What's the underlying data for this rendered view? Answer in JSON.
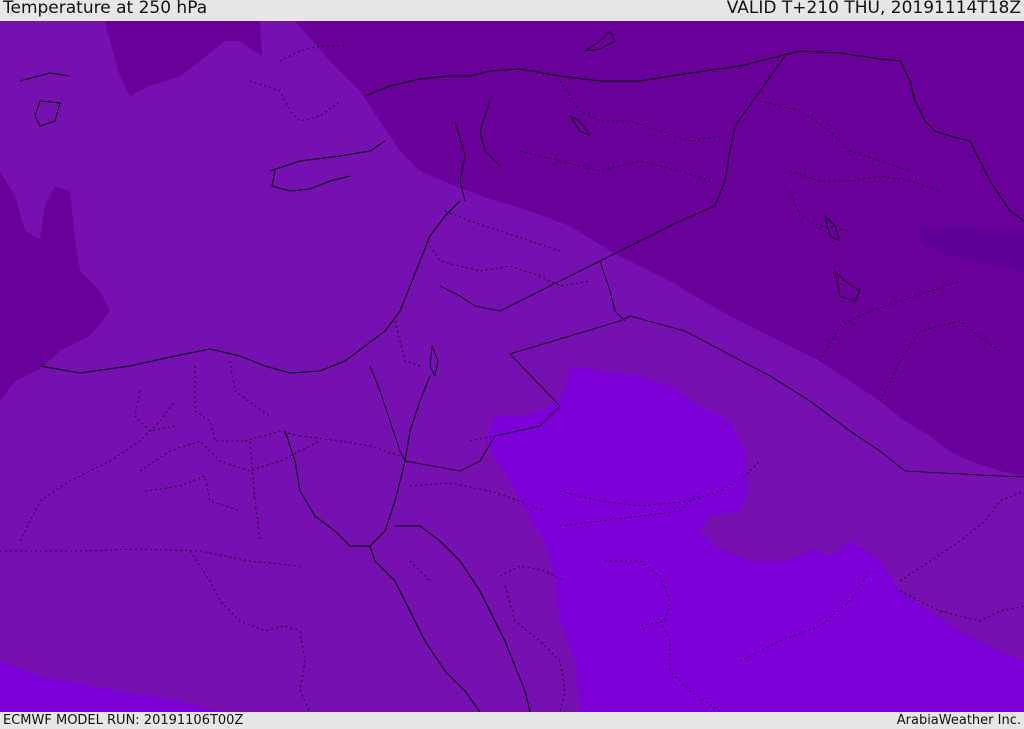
{
  "header": {
    "title": "Temperature at 250 hPa",
    "valid_time": "VALID T+210 THU, 20191114T18Z"
  },
  "footer": {
    "model_run": "ECMWF MODEL RUN: 20191106T00Z",
    "credit": "ArabiaWeather Inc."
  },
  "map": {
    "colors": {
      "darkest_band": "#5e0096",
      "dark_band": "#6a0099",
      "mid_band": "#7710b0",
      "light_band": "#7e00d8",
      "border_line": "#000000"
    }
  }
}
